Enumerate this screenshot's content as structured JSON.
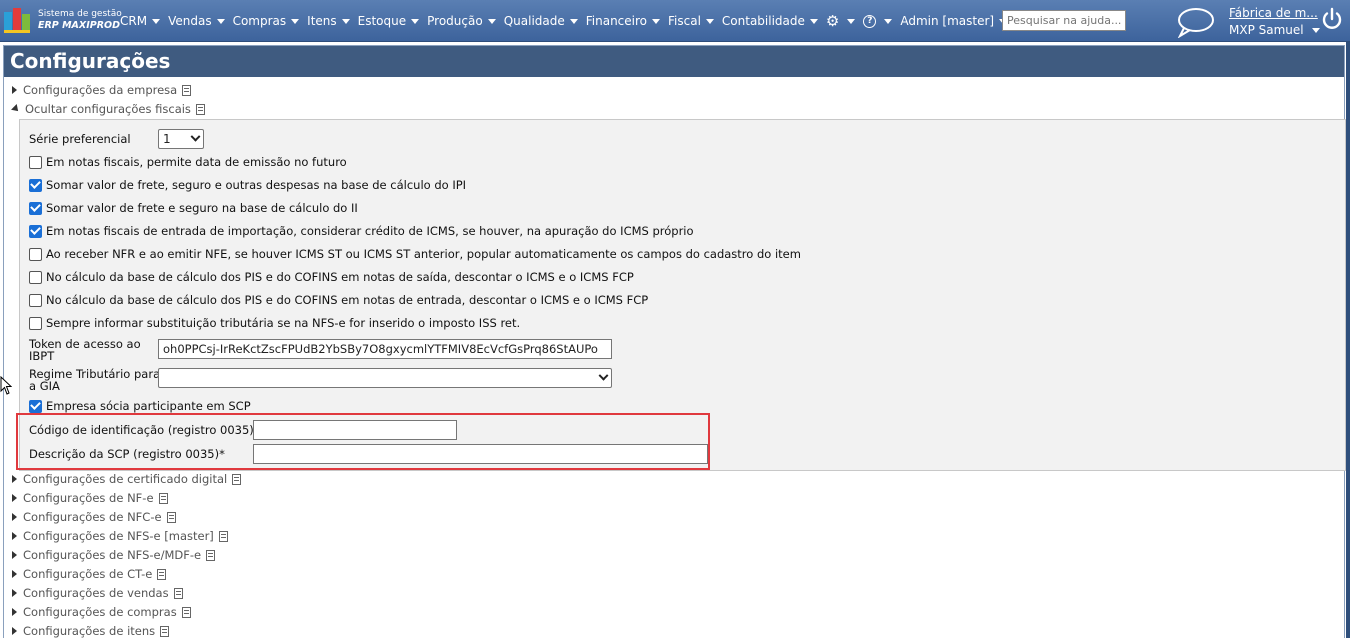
{
  "header": {
    "brand_line1": "Sistema de gestão",
    "brand_line2": "ERP MAXIPROD",
    "menu": [
      {
        "label": "CRM"
      },
      {
        "label": "Vendas"
      },
      {
        "label": "Compras"
      },
      {
        "label": "Itens"
      },
      {
        "label": "Estoque"
      },
      {
        "label": "Produção"
      },
      {
        "label": "Qualidade"
      },
      {
        "label": "Financeiro"
      },
      {
        "label": "Fiscal"
      },
      {
        "label": "Contabilidade"
      }
    ],
    "settings_icon": "gear-icon",
    "help_icon": "help-icon",
    "user_menu": "Admin [master]",
    "search_placeholder": "Pesquisar na ajuda...",
    "company": "Fábrica de m...",
    "user_name": "MXP Samuel",
    "colors": {
      "bar": "#4a70a8",
      "title": "#3f5b80",
      "accent": "#e0393e"
    }
  },
  "page": {
    "title": "Configurações",
    "sections_top": [
      {
        "label": "Configurações da empresa",
        "expanded": false
      },
      {
        "label": "Ocultar configurações fiscais",
        "expanded": true
      }
    ],
    "fiscal": {
      "serie_label": "Série preferencial",
      "serie_value": "1",
      "checkboxes": [
        {
          "label": "Em notas fiscais, permite data de emissão no futuro",
          "checked": false
        },
        {
          "label": "Somar valor de frete, seguro e outras despesas na base de cálculo do IPI",
          "checked": true
        },
        {
          "label": "Somar valor de frete e seguro na base de cálculo do II",
          "checked": true
        },
        {
          "label": "Em notas fiscais de entrada de importação, considerar crédito de ICMS, se houver, na apuração do ICMS próprio",
          "checked": true
        },
        {
          "label": "Ao receber NFR e ao emitir NFE, se houver ICMS ST ou ICMS ST anterior, popular automaticamente os campos do cadastro do item",
          "checked": false
        },
        {
          "label": "No cálculo da base de cálculo dos PIS e do COFINS em notas de saída, descontar o ICMS e o ICMS FCP",
          "checked": false
        },
        {
          "label": "No cálculo da base de cálculo dos PIS e do COFINS em notas de entrada, descontar o ICMS e o ICMS FCP",
          "checked": false
        },
        {
          "label": "Sempre informar substituição tributária se na NFS-e for inserido o imposto ISS ret.",
          "checked": false
        }
      ],
      "token_label_1": "Token de acesso ao",
      "token_label_2": "IBPT",
      "token_value": "oh0PPCsj-IrReKctZscFPUdB2YbSBy7O8gxycmlYTFMIV8EcVcfGsPrq86StAUPo",
      "regime_label_1": "Regime Tributário para",
      "regime_label_2": "a GIA",
      "regime_value": "",
      "scp_checkbox": {
        "label": "Empresa sócia participante em SCP",
        "checked": true
      },
      "scp_code_label": "Código de identificação (registro 0035)*",
      "scp_code_value": "",
      "scp_desc_label": "Descrição da SCP (registro 0035)*",
      "scp_desc_value": ""
    },
    "sections_bottom": [
      {
        "label": "Configurações de certificado digital"
      },
      {
        "label": "Configurações de NF-e"
      },
      {
        "label": "Configurações de NFC-e"
      },
      {
        "label": "Configurações de NFS-e [master]"
      },
      {
        "label": "Configurações de NFS-e/MDF-e"
      },
      {
        "label": "Configurações de CT-e"
      },
      {
        "label": "Configurações de vendas"
      },
      {
        "label": "Configurações de compras"
      },
      {
        "label": "Configurações de itens"
      }
    ]
  }
}
